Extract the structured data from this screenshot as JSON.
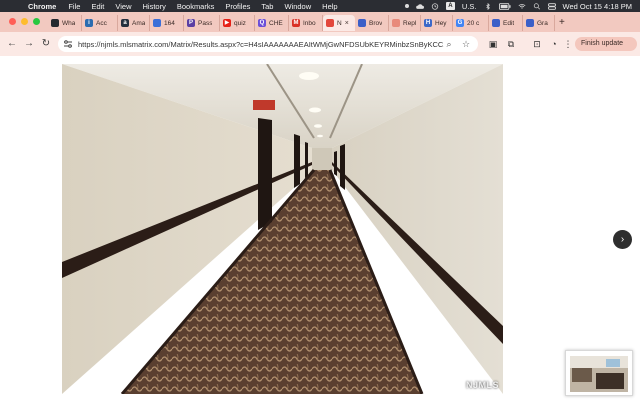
{
  "menubar": {
    "app_name": "Chrome",
    "menus": [
      "File",
      "Edit",
      "View",
      "History",
      "Bookmarks",
      "Profiles",
      "Tab",
      "Window",
      "Help"
    ],
    "input_source": "A",
    "input_region": "U.S.",
    "datetime": "Wed Oct 15  4:18 PM"
  },
  "tabs": [
    {
      "label": "Wha",
      "icon": "github-icon",
      "color": "#24292f",
      "glyph": ""
    },
    {
      "label": "Acc",
      "icon": "info-icon",
      "color": "#2b6cb0",
      "glyph": "i"
    },
    {
      "label": "Ama",
      "icon": "amazon-icon",
      "color": "#232f3e",
      "glyph": "a"
    },
    {
      "label": "164",
      "icon": "cloud-icon",
      "color": "#3b6fd8",
      "glyph": ""
    },
    {
      "label": "Pass",
      "icon": "password-icon",
      "color": "#5b3fa3",
      "glyph": "P"
    },
    {
      "label": "quiz",
      "icon": "youtube-icon",
      "color": "#e62117",
      "glyph": "▶"
    },
    {
      "label": "CHE",
      "icon": "search-q-icon",
      "color": "#6b4fd8",
      "glyph": "Q"
    },
    {
      "label": "Inbo",
      "icon": "gmail-icon",
      "color": "#d93025",
      "glyph": "M"
    },
    {
      "label": "N",
      "icon": "matrix-icon",
      "color": "#e3473b",
      "glyph": "",
      "active": true
    },
    {
      "label": "Brov",
      "icon": "browser-icon",
      "color": "#3b5fc8",
      "glyph": ""
    },
    {
      "label": "Repl",
      "icon": "reply-icon",
      "color": "#e88a7b",
      "glyph": ""
    },
    {
      "label": "Hey",
      "icon": "hey-icon",
      "color": "#3b68c8",
      "glyph": "H"
    },
    {
      "label": "20 c",
      "icon": "google-icon",
      "color": "#4285f4",
      "glyph": "G"
    },
    {
      "label": "Edit",
      "icon": "edit-icon",
      "color": "#3b5fc8",
      "glyph": ""
    },
    {
      "label": "Gra",
      "icon": "grammar-icon",
      "color": "#3b5fc8",
      "glyph": ""
    }
  ],
  "toolbar": {
    "url": "https://njmls.mlsmatrix.com/Matrix/Results.aspx?c=H4sIAAAAAAAEAItWMjGwNFDSUbKEYRMinbzSnByKCC...",
    "update_button": "Finish update"
  },
  "content": {
    "watermark": "NJMLS"
  },
  "colors": {
    "tabstrip": "#f2c9c0",
    "toolbar": "#fbe9e5",
    "menubar": "#2b2d33"
  }
}
